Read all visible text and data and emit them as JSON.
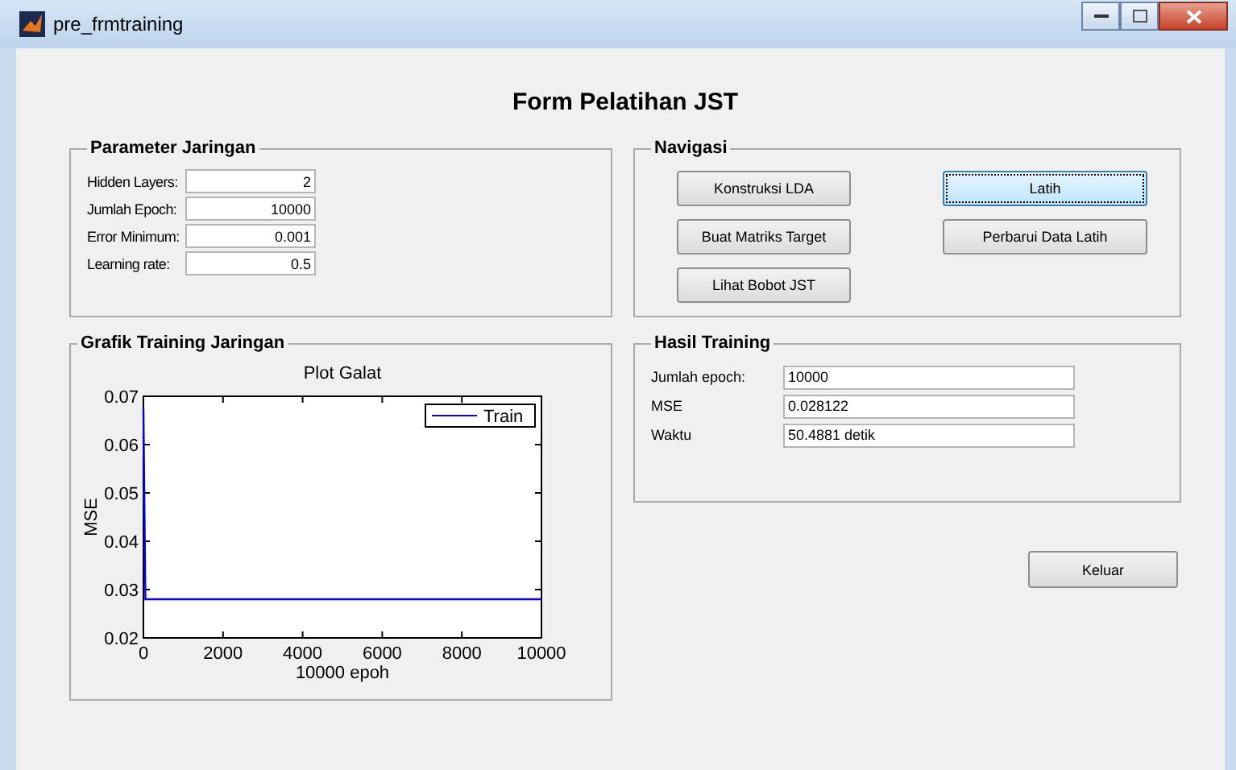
{
  "window": {
    "title": "pre_frmtraining"
  },
  "heading": "Form Pelatihan JST",
  "parameters": {
    "title": "Parameter Jaringan",
    "fields": [
      {
        "label": "Hidden Layers:",
        "value": "2"
      },
      {
        "label": "Jumlah Epoch:",
        "value": "10000"
      },
      {
        "label": "Error Minimum:",
        "value": "0.001"
      },
      {
        "label": "Learning rate:",
        "value": "0.5"
      }
    ]
  },
  "navigation": {
    "title": "Navigasi",
    "buttons": [
      {
        "label": "Konstruksi LDA",
        "focused": false
      },
      {
        "label": "Latih",
        "focused": true
      },
      {
        "label": "Buat Matriks Target",
        "focused": false
      },
      {
        "label": "Perbarui Data Latih",
        "focused": false
      },
      {
        "label": "Lihat Bobot JST",
        "focused": false
      }
    ]
  },
  "graph": {
    "title": "Grafik Training Jaringan",
    "chart_data": {
      "type": "line",
      "title": "Plot Galat",
      "xlabel": "10000 epoh",
      "ylabel": "MSE",
      "x": [
        0,
        50,
        10000
      ],
      "series": [
        {
          "name": "Train",
          "color": "#0000ff",
          "values": [
            0.0675,
            0.028,
            0.028
          ]
        }
      ],
      "xlim": [
        0,
        10000
      ],
      "ylim": [
        0.02,
        0.07
      ],
      "xticks": [
        0,
        2000,
        4000,
        6000,
        8000,
        10000
      ],
      "yticks": [
        0.02,
        0.03,
        0.04,
        0.05,
        0.06,
        0.07
      ]
    }
  },
  "results": {
    "title": "Hasil Training",
    "fields": [
      {
        "label": "Jumlah epoch:",
        "value": "10000"
      },
      {
        "label": "MSE",
        "value": "0.028122"
      },
      {
        "label": "Waktu",
        "value": "50.4881 detik"
      }
    ]
  },
  "exit_button": "Keluar"
}
